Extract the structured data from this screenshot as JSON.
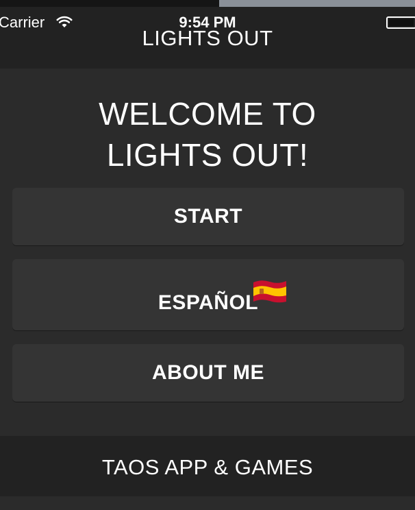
{
  "status_bar": {
    "carrier": "Carrier",
    "time": "9:54 PM",
    "wifi_icon": "wifi-icon",
    "battery_icon": "battery-icon"
  },
  "nav": {
    "title": "LIGHTS OUT"
  },
  "welcome": {
    "line1": "WELCOME TO",
    "line2": "LIGHTS OUT!"
  },
  "buttons": {
    "start": "START",
    "espanol": "ESPAÑOL",
    "espanol_icon": "spain-flag-icon",
    "about": "ABOUT ME"
  },
  "footer": {
    "text": "TAOS APP & GAMES"
  },
  "colors": {
    "background": "#2b2b2b",
    "bar": "#222222",
    "button": "#343434",
    "text": "#ffffff",
    "flag_red": "#c8102e",
    "flag_yellow": "#ffc400"
  }
}
